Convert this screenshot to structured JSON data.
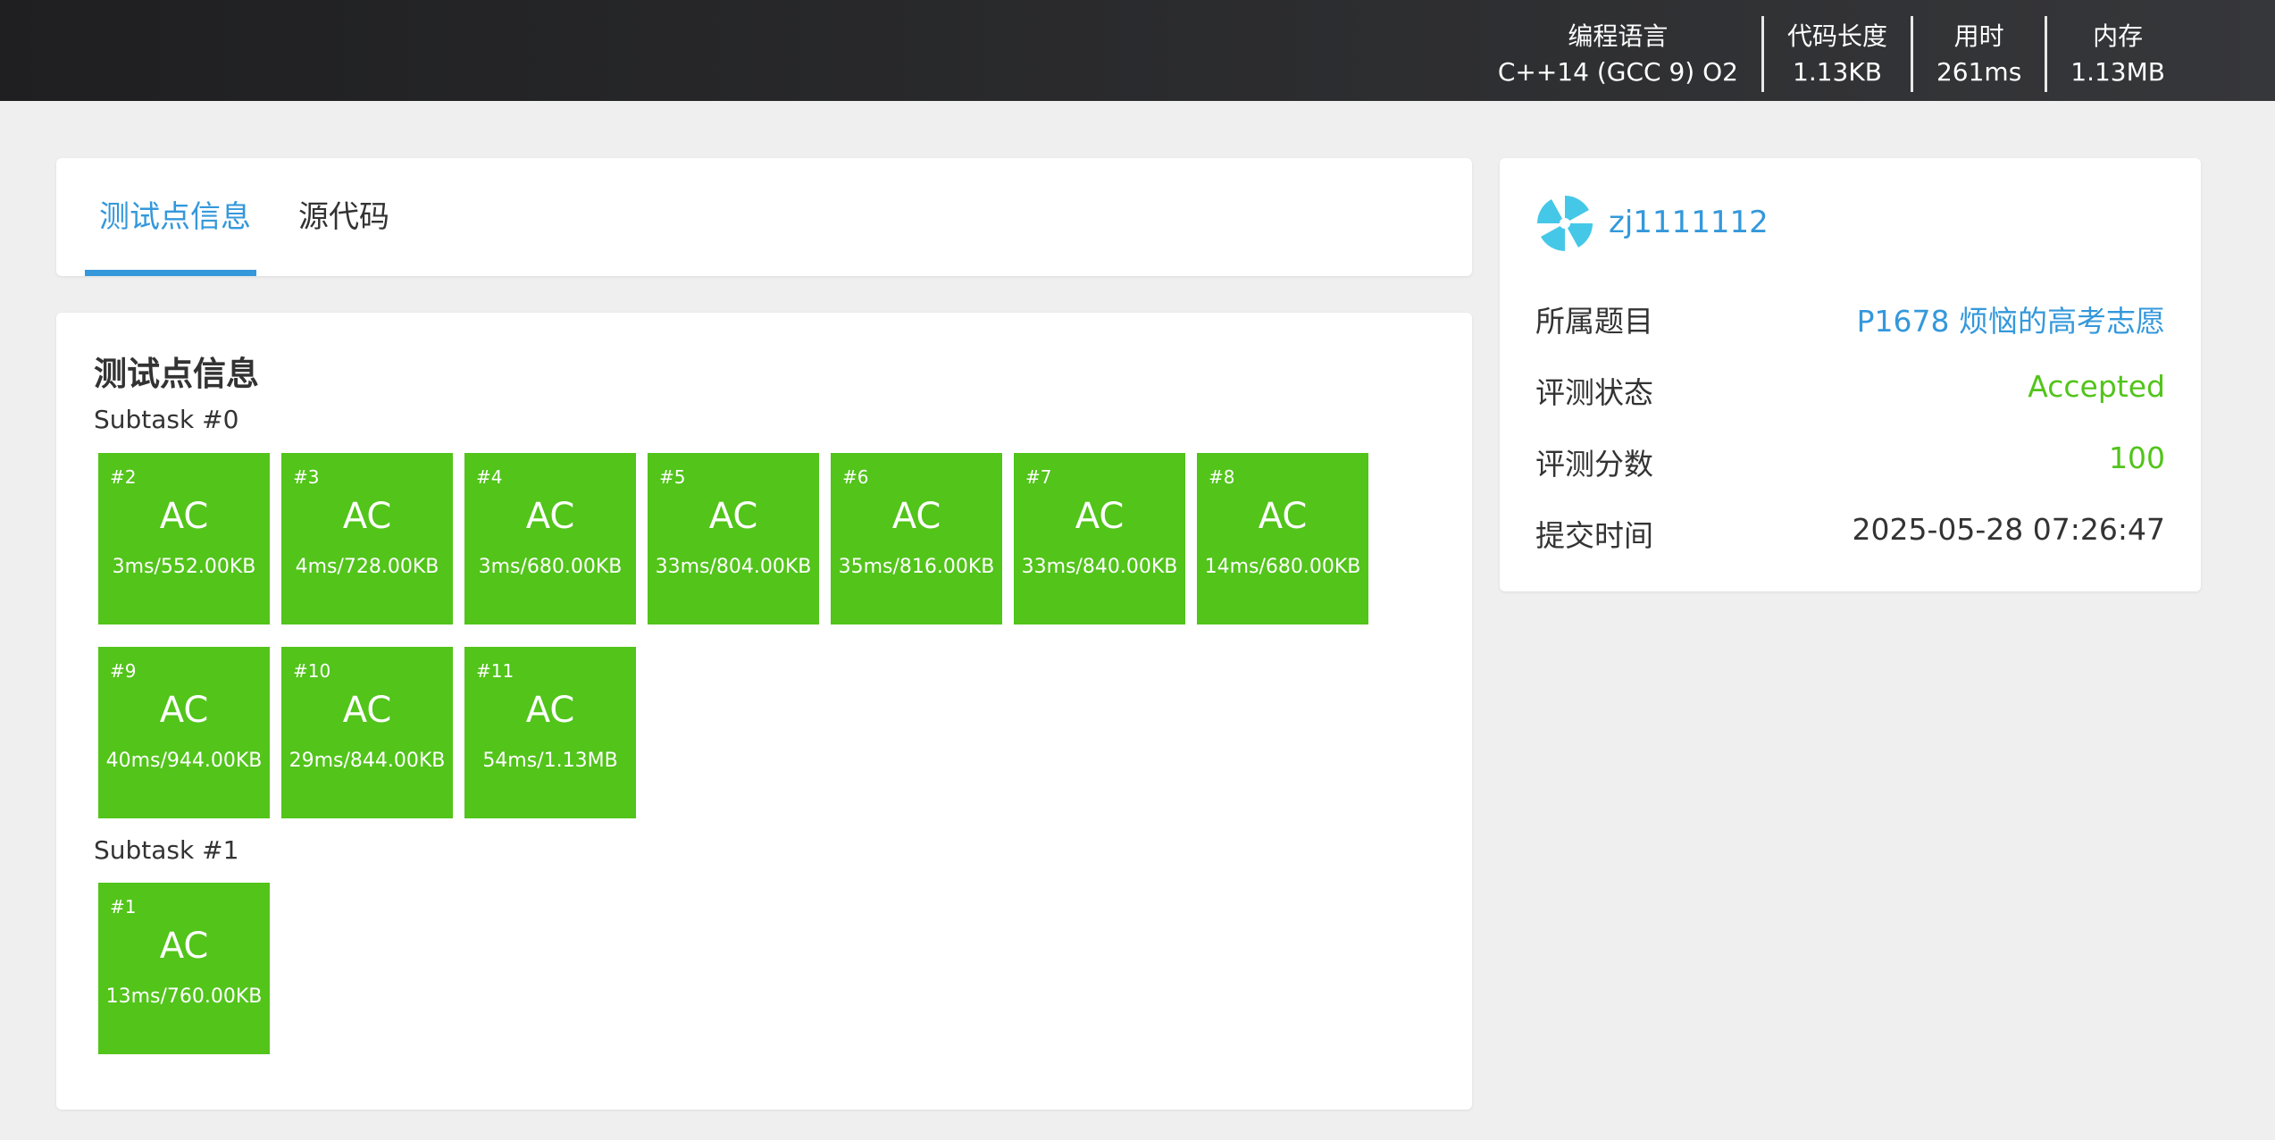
{
  "header": {
    "stats": [
      {
        "label": "编程语言",
        "value": "C++14 (GCC 9) O2"
      },
      {
        "label": "代码长度",
        "value": "1.13KB"
      },
      {
        "label": "用时",
        "value": "261ms"
      },
      {
        "label": "内存",
        "value": "1.13MB"
      }
    ]
  },
  "tabs": {
    "tests_label": "测试点信息",
    "source_label": "源代码",
    "active": "tests"
  },
  "tests": {
    "title": "测试点信息",
    "subtasks": [
      {
        "label": "Subtask #0",
        "cases": [
          {
            "id": "#2",
            "status": "AC",
            "info": "3ms/552.00KB"
          },
          {
            "id": "#3",
            "status": "AC",
            "info": "4ms/728.00KB"
          },
          {
            "id": "#4",
            "status": "AC",
            "info": "3ms/680.00KB"
          },
          {
            "id": "#5",
            "status": "AC",
            "info": "33ms/804.00KB"
          },
          {
            "id": "#6",
            "status": "AC",
            "info": "35ms/816.00KB"
          },
          {
            "id": "#7",
            "status": "AC",
            "info": "33ms/840.00KB"
          },
          {
            "id": "#8",
            "status": "AC",
            "info": "14ms/680.00KB"
          },
          {
            "id": "#9",
            "status": "AC",
            "info": "40ms/944.00KB"
          },
          {
            "id": "#10",
            "status": "AC",
            "info": "29ms/844.00KB"
          },
          {
            "id": "#11",
            "status": "AC",
            "info": "54ms/1.13MB"
          }
        ]
      },
      {
        "label": "Subtask #1",
        "cases": [
          {
            "id": "#1",
            "status": "AC",
            "info": "13ms/760.00KB"
          }
        ]
      }
    ],
    "ac_color": "#52c41a"
  },
  "info": {
    "username": "zj1111112",
    "avatar_icon": "avatar-icon",
    "rows": [
      {
        "label": "所属题目",
        "value": "P1678 烦恼的高考志愿"
      },
      {
        "label": "评测状态",
        "value": "Accepted"
      },
      {
        "label": "评测分数",
        "value": "100"
      },
      {
        "label": "提交时间",
        "value": "2025-05-28 07:26:47"
      }
    ]
  },
  "colors": {
    "accent": "#3498db",
    "success": "#52c41a",
    "header_bg": "#2a2b2d",
    "page_bg": "#efefef"
  }
}
